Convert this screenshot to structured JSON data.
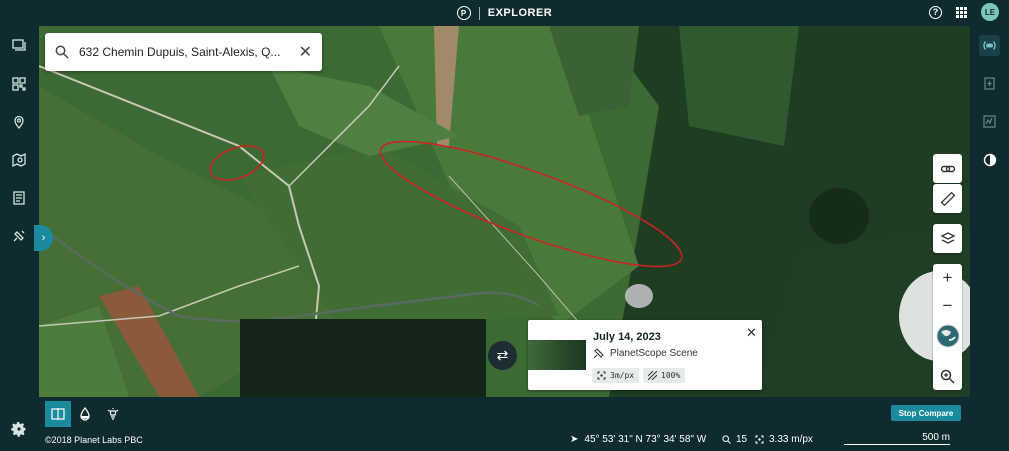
{
  "header": {
    "logo_letter": "P",
    "app_title": "EXPLORER",
    "help_symbol": "?",
    "user_initials": "LE"
  },
  "search": {
    "value": "632 Chemin Dupuis, Saint-Alexis, Q...",
    "clear_symbol": "✕"
  },
  "left_sidebar": {
    "items": [
      "layers-icon",
      "qr-grid-icon",
      "location-pin-icon",
      "map-search-icon",
      "document-list-icon",
      "satellite-icon"
    ],
    "settings": "gear-icon"
  },
  "right_sidebar": {
    "items": [
      "signal-icon",
      "export-icon",
      "chart-icon"
    ],
    "contrast": "contrast-icon"
  },
  "map_controls": {
    "link": "link-icon",
    "measure": "ruler-icon",
    "layers": "layers-icon",
    "zoom_in": "+",
    "zoom_out": "−",
    "zoom_search": "zoom-icon"
  },
  "scene": {
    "date": "July 14, 2023",
    "type": "PlanetScope Scene",
    "resolution": "3m/px",
    "coverage": "100%",
    "close_symbol": "✕"
  },
  "compare": {
    "swap_symbol": "⇄",
    "stop_label": "Stop Compare"
  },
  "bottom_tools": [
    "compare-split-icon",
    "water-drop-icon",
    "lightbulb-icon"
  ],
  "footer": {
    "copyright": "©2018 Planet Labs PBC",
    "coordinates": "45° 53' 31\" N 73° 34' 58\" W",
    "zoom": "15",
    "resolution": "3.33 m/px",
    "scale": "500 m"
  },
  "colors": {
    "chrome": "#0f2b30",
    "accent": "#1a8b9f",
    "annotation": "#d12020"
  }
}
